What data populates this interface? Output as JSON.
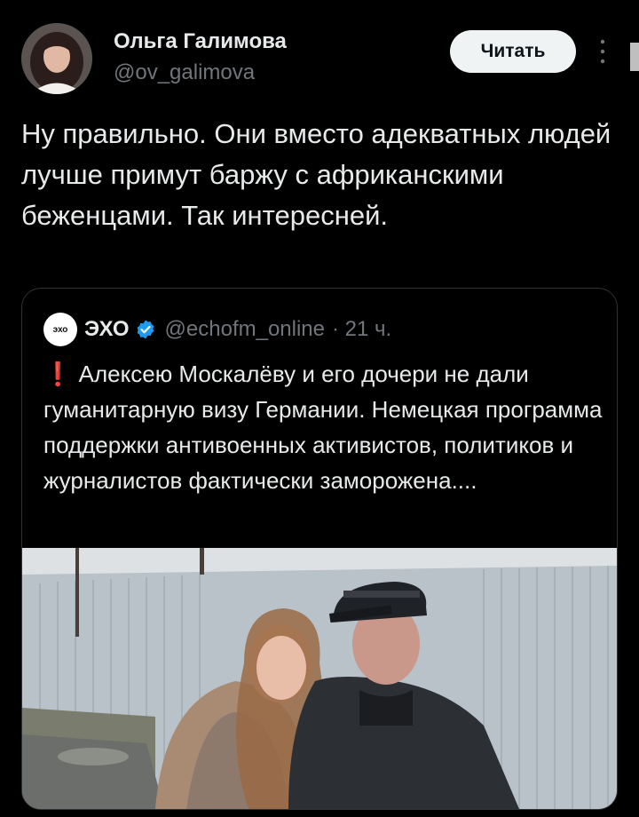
{
  "author": {
    "name": "Ольга Галимова",
    "handle": "@ov_galimova",
    "follow_label": "Читать"
  },
  "tweet": {
    "text": "Ну правильно. Они вместо адекватных людей лучше примут баржу с африканскими беженцами. Так интересней."
  },
  "quoted": {
    "logo_text": "эхо",
    "name": "ЭХО",
    "handle": "@echofm_online",
    "time": "· 21 ч.",
    "alert": "❗",
    "text": "Алексею Москалёву и его дочери не дали гуманитарную визу Германии. Немецкая программа поддержки антивоенных активистов, политиков и журналистов фактически заморожена...."
  },
  "colors": {
    "background": "#000000",
    "text": "#e7e9ea",
    "secondary": "#71767b",
    "verified": "#1d9bf0",
    "alert": "#f4212e"
  }
}
